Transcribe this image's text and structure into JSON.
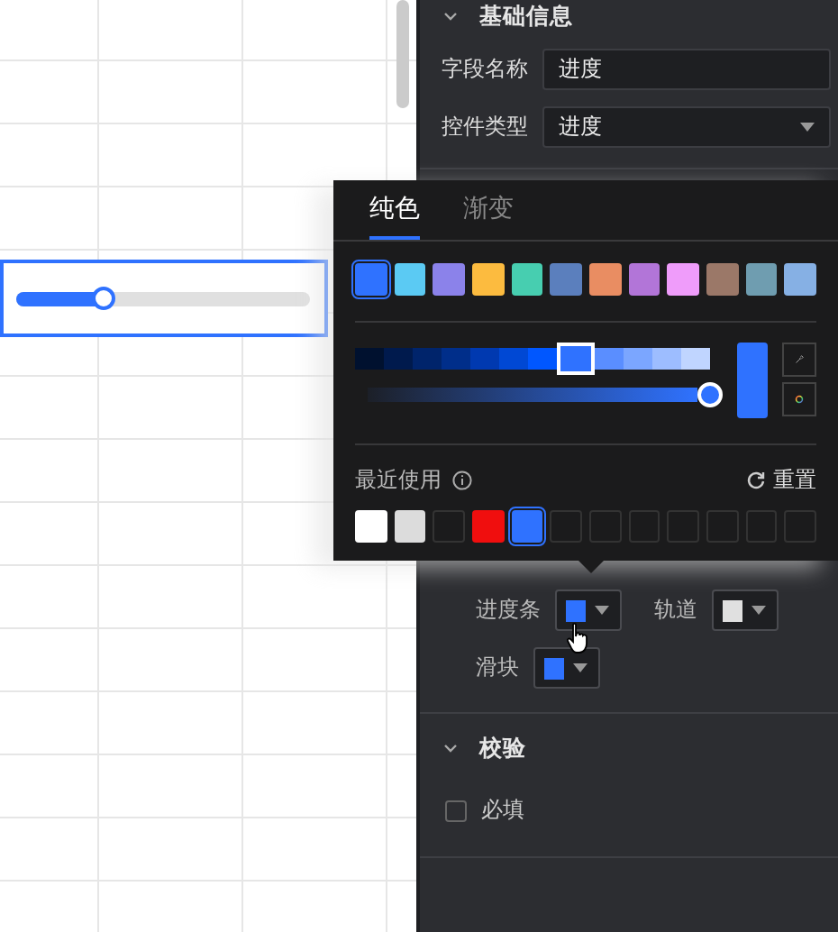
{
  "canvas": {
    "progress": {
      "level": 0.3,
      "selected": true
    }
  },
  "basic_section": {
    "title": "基础信息",
    "expanded": true,
    "fields": [
      {
        "kind": "input",
        "label": "字段名称",
        "value": "进度"
      },
      {
        "kind": "select",
        "label": "控件类型",
        "value": "进度"
      }
    ]
  },
  "color_style": {
    "items": [
      {
        "label": "进度条",
        "color": "#2f72ff"
      },
      {
        "label": "轨道",
        "color": "#e0e0e0"
      },
      {
        "label": "滑块",
        "color": "#2f72ff"
      }
    ]
  },
  "validation_section": {
    "title": "校验",
    "expanded": true,
    "options": [
      {
        "label": "必填",
        "checked": false
      }
    ]
  },
  "color_popup": {
    "tabs": [
      {
        "label": "纯色",
        "selected": true
      },
      {
        "label": "渐变",
        "selected": false
      }
    ],
    "presets": [
      {
        "color": "#2f72ff",
        "selected": true
      },
      {
        "color": "#5bcaf3",
        "selected": false
      },
      {
        "color": "#8b82ea",
        "selected": false
      },
      {
        "color": "#fcbb3f",
        "selected": false
      },
      {
        "color": "#47ceb0",
        "selected": false
      },
      {
        "color": "#5b7fbd",
        "selected": false
      },
      {
        "color": "#e98d62",
        "selected": false
      },
      {
        "color": "#b275d8",
        "selected": false
      },
      {
        "color": "#ef9cfa",
        "selected": false
      },
      {
        "color": "#9b7868",
        "selected": false
      },
      {
        "color": "#6f9db0",
        "selected": false
      },
      {
        "color": "#86b0e4",
        "selected": false
      }
    ],
    "shades": [
      {
        "color": "#00112f",
        "selected": false
      },
      {
        "color": "#001a4d",
        "selected": false
      },
      {
        "color": "#00246b",
        "selected": false
      },
      {
        "color": "#002e8a",
        "selected": false
      },
      {
        "color": "#0039b0",
        "selected": false
      },
      {
        "color": "#0048d4",
        "selected": false
      },
      {
        "color": "#0057ff",
        "selected": false
      },
      {
        "color": "#2f72ff",
        "selected": true
      },
      {
        "color": "#5a8eff",
        "selected": false
      },
      {
        "color": "#7ba6ff",
        "selected": false
      },
      {
        "color": "#9dbdff",
        "selected": false
      },
      {
        "color": "#c0d5ff",
        "selected": false
      }
    ],
    "alpha": {
      "level": 1
    },
    "recent_title": "最近使用",
    "reset_label": "重置",
    "recent": [
      {
        "kind": "swatch",
        "color": "#ffffff",
        "selected": false
      },
      {
        "kind": "swatch",
        "color": "#dcdcdc",
        "selected": false
      },
      {
        "kind": "empty",
        "selected": false
      },
      {
        "kind": "swatch",
        "color": "#f00e0e",
        "selected": false
      },
      {
        "kind": "swatch",
        "color": "#2f72ff",
        "selected": true
      },
      {
        "kind": "empty",
        "selected": false
      },
      {
        "kind": "empty",
        "selected": false
      },
      {
        "kind": "empty",
        "selected": false
      },
      {
        "kind": "empty",
        "selected": false
      },
      {
        "kind": "empty",
        "selected": false
      },
      {
        "kind": "empty",
        "selected": false
      },
      {
        "kind": "empty",
        "selected": false
      }
    ]
  }
}
